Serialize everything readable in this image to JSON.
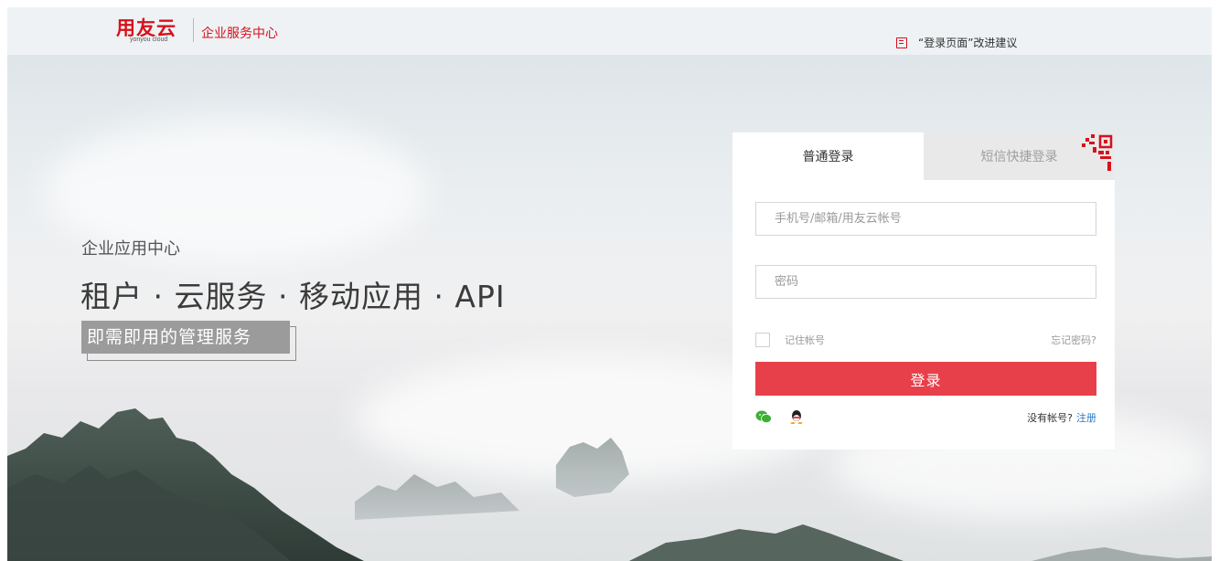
{
  "header": {
    "logo_text": "用友云",
    "logo_subtext": "yonyou cloud",
    "title": "企业服务中心",
    "feedback_label": "“登录页面”改进建议"
  },
  "promo": {
    "subtitle": "企业应用中心",
    "headline": "租户 · 云服务 · 移动应用 · API",
    "tagline": "即需即用的管理服务"
  },
  "login": {
    "tabs": [
      {
        "label": "普通登录",
        "active": true
      },
      {
        "label": "短信快捷登录",
        "active": false
      }
    ],
    "account_placeholder": "手机号/邮箱/用友云帐号",
    "password_placeholder": "密码",
    "remember_label": "记住帐号",
    "forgot_label": "忘记密码?",
    "submit_label": "登录",
    "social": [
      "wechat-icon",
      "qq-icon"
    ],
    "no_account_label": "没有帐号?",
    "register_label": "注册"
  },
  "colors": {
    "brand_red": "#d7111c",
    "button_red": "#e8404a",
    "link_blue": "#2f79c4"
  }
}
